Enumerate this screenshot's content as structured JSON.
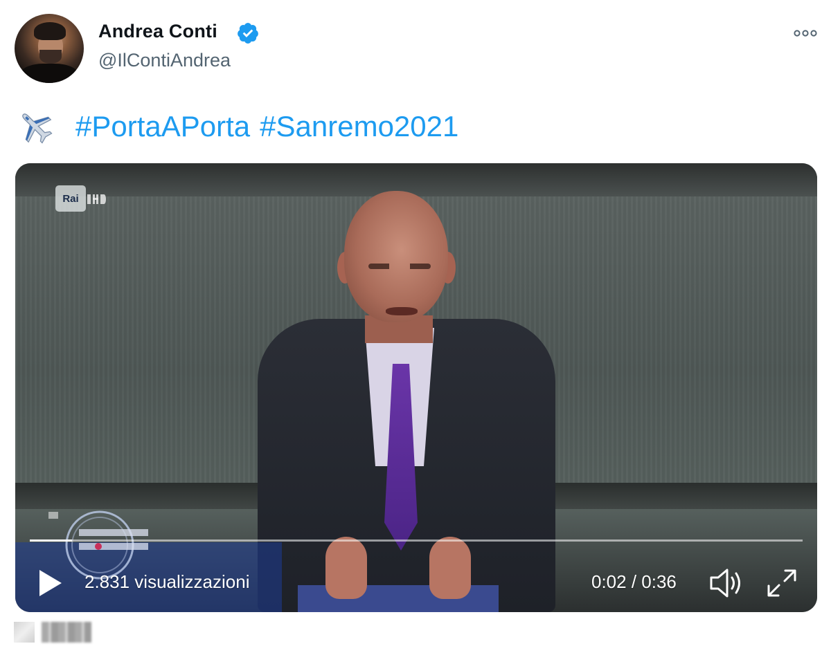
{
  "tweet": {
    "author": {
      "display_name": "Andrea Conti",
      "handle": "@IlContiAndrea",
      "verified": true,
      "avatar_icon": "profile-photo"
    },
    "more_icon": "more-horizontal-icon",
    "text": {
      "emoji_icon": "airplane-emoji",
      "hashtags": [
        "#PortaAPorta",
        "#Sanremo2021"
      ]
    },
    "video": {
      "channel_logo": "Rai",
      "views_label": "2.831 visualizzazioni",
      "time_label": "0:02 / 0:36",
      "progress": 0.055,
      "play_icon": "play-icon",
      "volume_icon": "volume-icon",
      "fullscreen_icon": "fullscreen-icon"
    }
  },
  "colors": {
    "link": "#1d9bf0",
    "verified": "#1d9bf0",
    "handle": "#536471",
    "name": "#0f1419"
  }
}
